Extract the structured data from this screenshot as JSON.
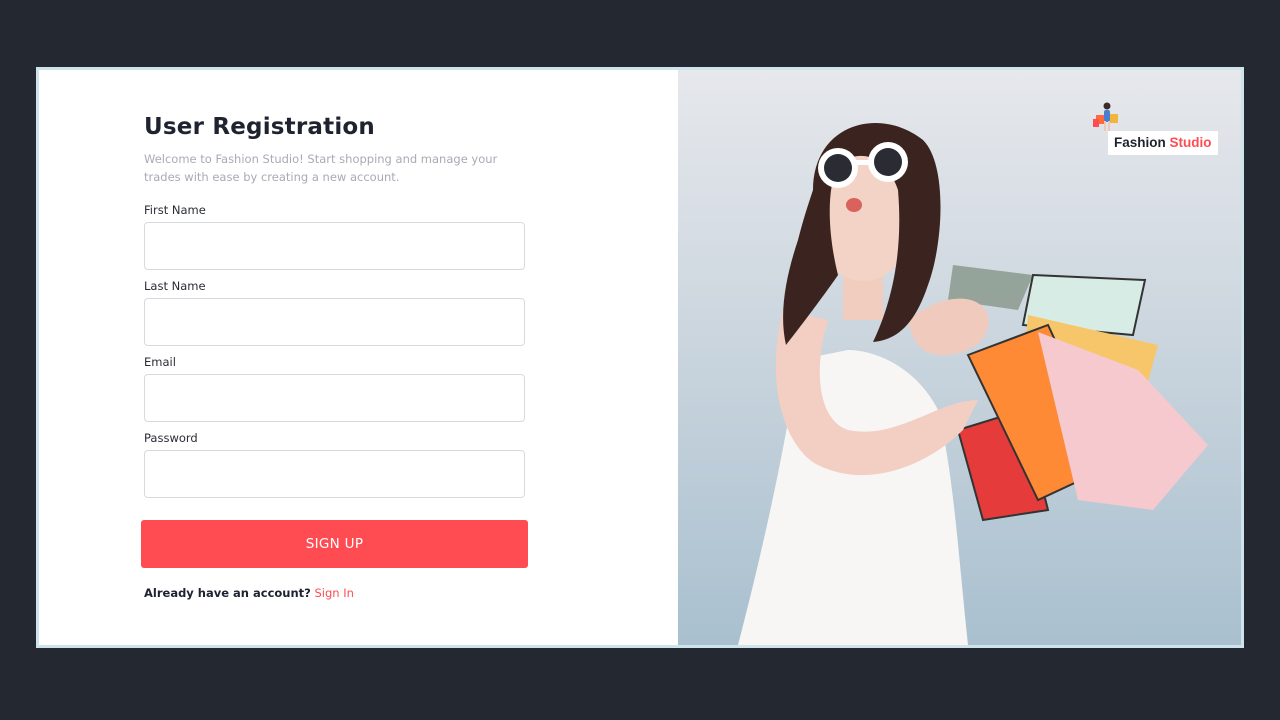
{
  "form": {
    "title": "User Registration",
    "subtitle": "Welcome to Fashion Studio! Start shopping and manage your trades with ease by creating a new account.",
    "fields": [
      {
        "label": "First Name",
        "value": "",
        "placeholder": ""
      },
      {
        "label": "Last Name",
        "value": "",
        "placeholder": ""
      },
      {
        "label": "Email",
        "value": "",
        "placeholder": ""
      },
      {
        "label": "Password",
        "value": "",
        "placeholder": ""
      }
    ],
    "submit_label": "SIGN UP",
    "signin_prompt": "Already have an account?",
    "signin_link": "Sign In"
  },
  "brand": {
    "name_part1": "Fashion",
    "name_part2": "Studio",
    "icon": "shopping-figure-icon"
  },
  "hero": {
    "icon": "woman-with-shopping-bags-illustration"
  },
  "colors": {
    "page_background": "#242831",
    "accent": "#ff4b52",
    "card_border": "#cfe3ec",
    "title_text": "#1f2330",
    "subtitle_text": "#a8abb4"
  }
}
